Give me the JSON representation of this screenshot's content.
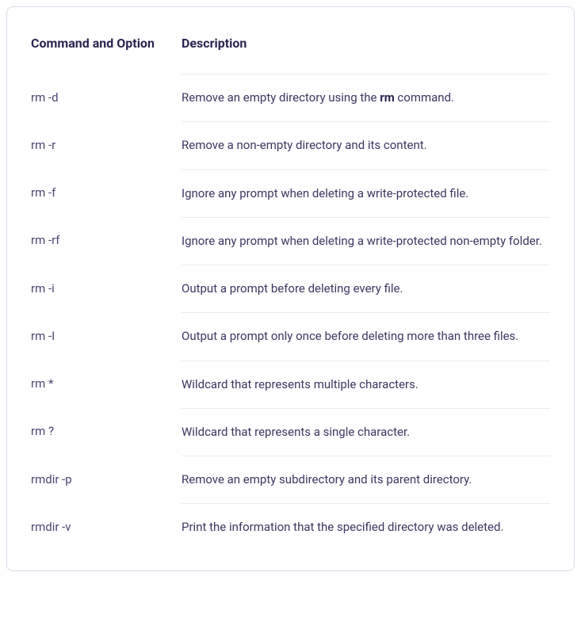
{
  "table": {
    "headers": {
      "command": "Command and Option",
      "description": "Description"
    },
    "rows": [
      {
        "command": "rm -d",
        "desc_pre": "Remove an empty directory using the ",
        "desc_bold": "rm",
        "desc_post": " command."
      },
      {
        "command": "rm -r",
        "desc_pre": "Remove a non-empty directory and its content.",
        "desc_bold": "",
        "desc_post": ""
      },
      {
        "command": "rm -f",
        "desc_pre": "Ignore any prompt when deleting a write-protected file.",
        "desc_bold": "",
        "desc_post": ""
      },
      {
        "command": "rm -rf",
        "desc_pre": "Ignore any prompt when deleting a write-protected non-empty folder.",
        "desc_bold": "",
        "desc_post": ""
      },
      {
        "command": "rm -i",
        "desc_pre": "Output a prompt before deleting every file.",
        "desc_bold": "",
        "desc_post": ""
      },
      {
        "command": "rm -I",
        "desc_pre": "Output a prompt only once before deleting more than three files.",
        "desc_bold": "",
        "desc_post": ""
      },
      {
        "command": "rm *",
        "desc_pre": "Wildcard that represents multiple characters.",
        "desc_bold": "",
        "desc_post": ""
      },
      {
        "command": "rm ?",
        "desc_pre": "Wildcard that represents a single character.",
        "desc_bold": "",
        "desc_post": ""
      },
      {
        "command": "rmdir -p",
        "desc_pre": "Remove an empty subdirectory and its parent directory.",
        "desc_bold": "",
        "desc_post": ""
      },
      {
        "command": "rmdir -v",
        "desc_pre": "Print the information that the specified directory was deleted.",
        "desc_bold": "",
        "desc_post": ""
      }
    ]
  }
}
